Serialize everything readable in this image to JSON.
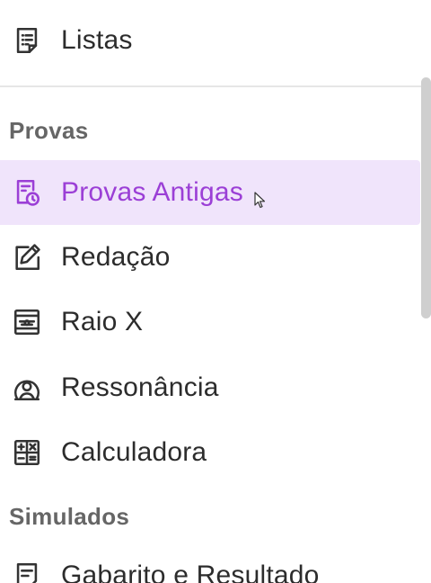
{
  "nav": {
    "top_item": {
      "label": "Listas",
      "icon": "list-document-icon"
    },
    "sections": [
      {
        "title": "Provas",
        "items": [
          {
            "label": "Provas Antigas",
            "icon": "exam-clock-icon",
            "active": true
          },
          {
            "label": "Redação",
            "icon": "edit-square-icon"
          },
          {
            "label": "Raio X",
            "icon": "xray-screen-icon"
          },
          {
            "label": "Ressonância",
            "icon": "scanner-person-icon"
          },
          {
            "label": "Calculadora",
            "icon": "calculator-icon"
          }
        ]
      },
      {
        "title": "Simulados",
        "items": [
          {
            "label": "Gabarito e Resultado",
            "icon": "answer-sheet-icon"
          }
        ]
      }
    ]
  },
  "colors": {
    "active_bg": "#f0e4fb",
    "active_fg": "#9b3fd6",
    "text": "#2c2c2c",
    "section_title": "#666666"
  }
}
